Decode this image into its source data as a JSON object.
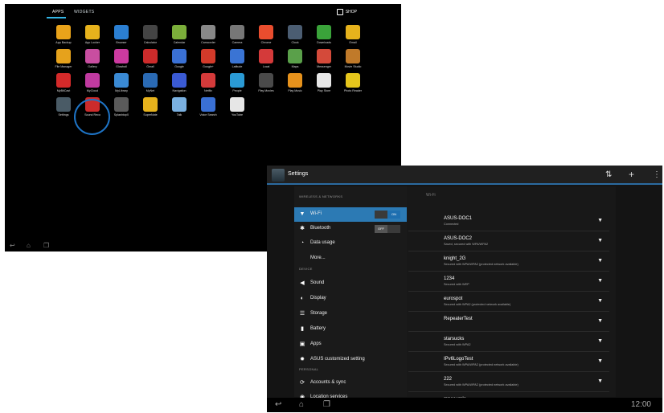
{
  "drawer": {
    "tabs": [
      "APPS",
      "WIDGETS"
    ],
    "shop_label": "SHOP",
    "apps": [
      {
        "label": "App Backup",
        "color": "#e9a31a"
      },
      {
        "label": "App Locker",
        "color": "#e6b21c"
      },
      {
        "label": "Browser",
        "color": "#2b7fd2"
      },
      {
        "label": "Calculator",
        "color": "#444"
      },
      {
        "label": "Calendar",
        "color": "#7bae3a"
      },
      {
        "label": "Camcorder",
        "color": "#888"
      },
      {
        "label": "Camera",
        "color": "#777"
      },
      {
        "label": "Chrome",
        "color": "#e94d2e"
      },
      {
        "label": "Clock",
        "color": "#4b5d72"
      },
      {
        "label": "Downloads",
        "color": "#3aa33a"
      },
      {
        "label": "Email",
        "color": "#e6b21c"
      },
      {
        "label": "File Manager",
        "color": "#e6a21c"
      },
      {
        "label": "Gallery",
        "color": "#c84ea0"
      },
      {
        "label": "Glowball",
        "color": "#cc3aa0"
      },
      {
        "label": "Gmail",
        "color": "#cc2b2b"
      },
      {
        "label": "Google",
        "color": "#3a70d4"
      },
      {
        "label": "Google+",
        "color": "#d33a2a"
      },
      {
        "label": "Latitude",
        "color": "#3a74d4"
      },
      {
        "label": "Local",
        "color": "#d43a3a"
      },
      {
        "label": "Maps",
        "color": "#5aa04a"
      },
      {
        "label": "Messenger",
        "color": "#d44a3a"
      },
      {
        "label": "Movie Studio",
        "color": "#c07a2a"
      },
      {
        "label": "MyBitCast",
        "color": "#d42a2a"
      },
      {
        "label": "MyCloud",
        "color": "#c03aa0"
      },
      {
        "label": "MyLibrary",
        "color": "#3a8ad4"
      },
      {
        "label": "MyNet",
        "color": "#2a6ab4"
      },
      {
        "label": "Navigation",
        "color": "#3a5ad4"
      },
      {
        "label": "Netflix",
        "color": "#d43a3a"
      },
      {
        "label": "People",
        "color": "#2a9ad4"
      },
      {
        "label": "Play Movies",
        "color": "#4a4a4a"
      },
      {
        "label": "Play Music",
        "color": "#e6921c"
      },
      {
        "label": "Play Store",
        "color": "#e6e6e6"
      },
      {
        "label": "Photo Reader",
        "color": "#e6c61c"
      },
      {
        "label": "Settings",
        "color": "#4a5b66"
      },
      {
        "label": "Sound Reco",
        "color": "#cc2b2b"
      },
      {
        "label": "SplashtopX",
        "color": "#5a5a5a"
      },
      {
        "label": "SuperNote",
        "color": "#e6b21c"
      },
      {
        "label": "Talk",
        "color": "#7ab0e0"
      },
      {
        "label": "Voice Search",
        "color": "#3a70d4"
      },
      {
        "label": "YouTube",
        "color": "#e6e6e6"
      }
    ]
  },
  "settings": {
    "title": "Settings",
    "sections": {
      "wireless": "WIRELESS & NETWORKS",
      "device": "DEVICE",
      "personal": "PERSONAL"
    },
    "items": [
      {
        "label": "Wi-Fi",
        "icon": "wifi-icon",
        "glyph": "▼"
      },
      {
        "label": "Bluetooth",
        "icon": "bluetooth-icon",
        "glyph": "✱"
      },
      {
        "label": "Data usage",
        "icon": "data-usage-icon",
        "glyph": "◔"
      },
      {
        "label": "More...",
        "icon": "",
        "glyph": ""
      },
      {
        "label": "Sound",
        "icon": "sound-icon",
        "glyph": "◀"
      },
      {
        "label": "Display",
        "icon": "display-icon",
        "glyph": "◐"
      },
      {
        "label": "Storage",
        "icon": "storage-icon",
        "glyph": "☰"
      },
      {
        "label": "Battery",
        "icon": "battery-icon",
        "glyph": "▮"
      },
      {
        "label": "Apps",
        "icon": "apps-icon",
        "glyph": "▣"
      },
      {
        "label": "ASUS customized setting",
        "icon": "gear-icon",
        "glyph": "✹"
      },
      {
        "label": "Accounts & sync",
        "icon": "sync-icon",
        "glyph": "⟳"
      },
      {
        "label": "Location services",
        "icon": "location-icon",
        "glyph": "◉"
      }
    ],
    "wifi_toggle": {
      "off": "",
      "on": "ON"
    },
    "bt_toggle": {
      "off": "OFF",
      "on": ""
    },
    "wifi_header": "Wi-Fi",
    "networks": [
      {
        "name": "ASUS-DOC1",
        "detail": "Connected"
      },
      {
        "name": "ASUS-DOC2",
        "detail": "Saved, secured with WPA/WPA2"
      },
      {
        "name": "knight_2G",
        "detail": "Secured with WPA/WPA2 (protected network available)"
      },
      {
        "name": "1234",
        "detail": "Secured with WEP"
      },
      {
        "name": "eurospot",
        "detail": "Secured with WPA2 (protected network available)"
      },
      {
        "name": "RepeaterTest",
        "detail": ""
      },
      {
        "name": "starsucks",
        "detail": "Secured with WPA2"
      },
      {
        "name": "IPv6LogoTest",
        "detail": "Secured with WPA/WPA2 (protected network available)"
      },
      {
        "name": "222",
        "detail": "Secured with WPA/WPA2 (protected network available)"
      },
      {
        "name": "mpecurple",
        "detail": ""
      }
    ],
    "clock": "12:00"
  }
}
